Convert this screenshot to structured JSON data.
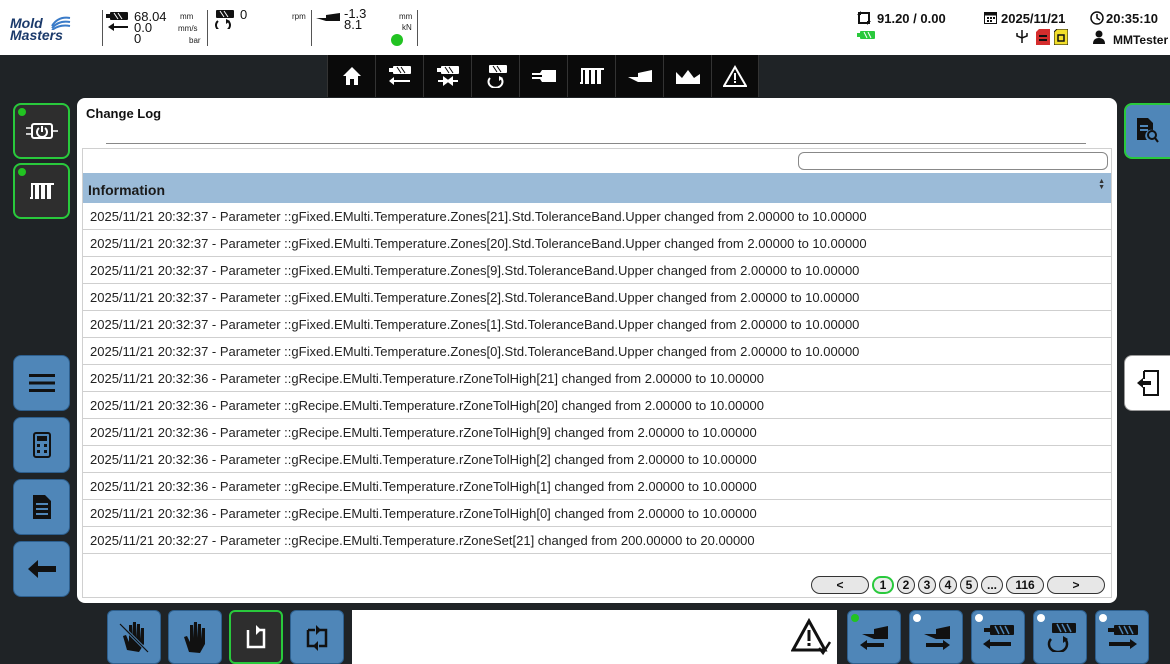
{
  "logo": {
    "line1": "Mold",
    "line2": "Masters"
  },
  "status": {
    "injection_value": "68.04",
    "injection_unit": "mm",
    "speed_value": "0.0",
    "speed_unit": "mm/s",
    "pressure_value": "0",
    "pressure_unit": "bar",
    "screw_value": "0",
    "screw_unit": "rpm",
    "mold_value_1": "-1.3",
    "mold_unit_1": "mm",
    "mold_value_2": "8.1",
    "mold_unit_2": "kN",
    "cycle_value": "91.20 / 0.00",
    "date": "2025/11/21",
    "time": "20:35:10",
    "user": "MMTester"
  },
  "nav_icons": [
    "home-icon",
    "injection-retract-icon",
    "injection-hold-icon",
    "screw-rotate-icon",
    "nozzle-icon",
    "heater-zones-icon",
    "clamp-icon",
    "ejector-icon",
    "warning-icon"
  ],
  "side": {
    "left_top": [
      "power-heater-icon",
      "heater-zones-icon"
    ],
    "left_bottom": [
      "menu-icon",
      "calculator-icon",
      "document-icon",
      "back-arrow-icon"
    ],
    "right_top": "report-search-icon",
    "right_mid": "exit-door-icon"
  },
  "panel": {
    "title": "Change Log",
    "search_placeholder": "",
    "column_header": "Information",
    "rows": [
      "2025/11/21 20:32:37 - Parameter ::gFixed.EMulti.Temperature.Zones[21].Std.ToleranceBand.Upper changed from 2.00000 to 10.00000",
      "2025/11/21 20:32:37 - Parameter ::gFixed.EMulti.Temperature.Zones[20].Std.ToleranceBand.Upper changed from 2.00000 to 10.00000",
      "2025/11/21 20:32:37 - Parameter ::gFixed.EMulti.Temperature.Zones[9].Std.ToleranceBand.Upper changed from 2.00000 to 10.00000",
      "2025/11/21 20:32:37 - Parameter ::gFixed.EMulti.Temperature.Zones[2].Std.ToleranceBand.Upper changed from 2.00000 to 10.00000",
      "2025/11/21 20:32:37 - Parameter ::gFixed.EMulti.Temperature.Zones[1].Std.ToleranceBand.Upper changed from 2.00000 to 10.00000",
      "2025/11/21 20:32:37 - Parameter ::gFixed.EMulti.Temperature.Zones[0].Std.ToleranceBand.Upper changed from 2.00000 to 10.00000",
      "2025/11/21 20:32:36 - Parameter ::gRecipe.EMulti.Temperature.rZoneTolHigh[21] changed from 2.00000 to 10.00000",
      "2025/11/21 20:32:36 - Parameter ::gRecipe.EMulti.Temperature.rZoneTolHigh[20] changed from 2.00000 to 10.00000",
      "2025/11/21 20:32:36 - Parameter ::gRecipe.EMulti.Temperature.rZoneTolHigh[9] changed from 2.00000 to 10.00000",
      "2025/11/21 20:32:36 - Parameter ::gRecipe.EMulti.Temperature.rZoneTolHigh[2] changed from 2.00000 to 10.00000",
      "2025/11/21 20:32:36 - Parameter ::gRecipe.EMulti.Temperature.rZoneTolHigh[1] changed from 2.00000 to 10.00000",
      "2025/11/21 20:32:36 - Parameter ::gRecipe.EMulti.Temperature.rZoneTolHigh[0] changed from 2.00000 to 10.00000",
      "2025/11/21 20:32:27 - Parameter ::gRecipe.EMulti.Temperature.rZoneSet[21] changed from 200.00000 to 20.00000"
    ],
    "pager": {
      "prev": "<",
      "pages": [
        "1",
        "2",
        "3",
        "4",
        "5",
        "...",
        "116"
      ],
      "selected_page": "1",
      "next": ">"
    }
  },
  "bottom": {
    "left_buttons": [
      "manual-hand-off-icon",
      "manual-hand-icon",
      "single-cycle-icon",
      "auto-cycle-icon"
    ],
    "message_icon": "alarm-acknowledge-icon",
    "right_buttons": [
      "clamp-open-icon",
      "clamp-close-icon",
      "injection-back-icon",
      "screw-recover-icon",
      "injection-forward-icon"
    ]
  },
  "colors": {
    "accent_green": "#29c93c",
    "button_blue": "#4f86b8",
    "header_blue": "#9bbbd8",
    "background": "#1f2326"
  }
}
